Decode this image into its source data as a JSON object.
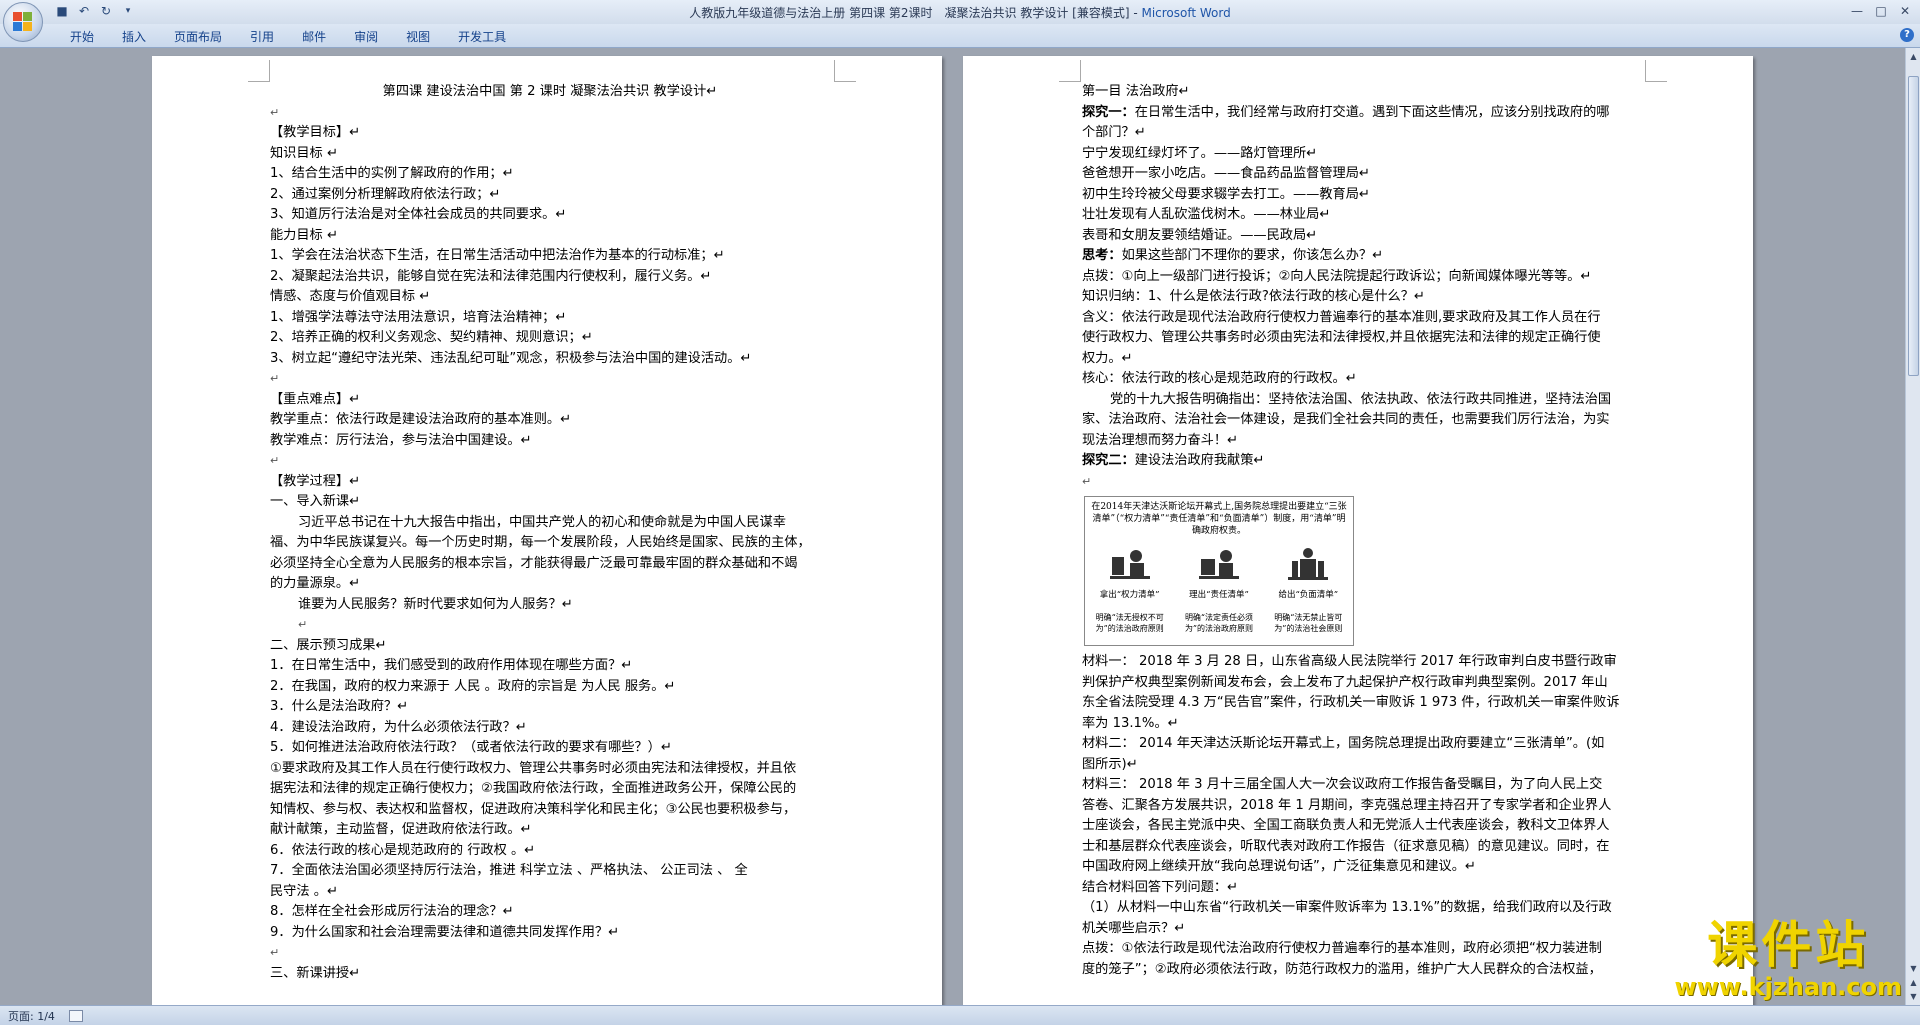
{
  "window": {
    "title": "人教版九年级道德与法治上册 第四课 第2课时　凝聚法治共识 教学设计 [兼容模式] - ",
    "app_name": "Microsoft Word"
  },
  "ribbon": {
    "tabs": [
      "开始",
      "插入",
      "页面布局",
      "引用",
      "邮件",
      "审阅",
      "视图",
      "开发工具"
    ]
  },
  "left_page": {
    "lines": [
      {
        "text": "第四课  建设法治中国    第 2 课时    凝聚法治共识    教学设计↵",
        "style": "center"
      },
      {
        "text": "↵",
        "style": "mark"
      },
      {
        "text": "【教学目标】↵",
        "style": ""
      },
      {
        "text": "知识目标      ↵",
        "style": ""
      },
      {
        "text": "1、结合生活中的实例了解政府的作用；↵",
        "style": ""
      },
      {
        "text": "2、通过案例分析理解政府依法行政；↵",
        "style": ""
      },
      {
        "text": "3、知道厉行法治是对全体社会成员的共同要求。↵",
        "style": ""
      },
      {
        "text": "能力目标      ↵",
        "style": ""
      },
      {
        "text": "1、学会在法治状态下生活，在日常生活活动中把法治作为基本的行动标准；↵",
        "style": ""
      },
      {
        "text": "2、凝聚起法治共识，能够自觉在宪法和法律范围内行使权利，履行义务。↵",
        "style": ""
      },
      {
        "text": "情感、态度与价值观目标    ↵",
        "style": ""
      },
      {
        "text": "1、增强学法尊法守法用法意识，培育法治精神；↵",
        "style": ""
      },
      {
        "text": "2、培养正确的权利义务观念、契约精神、规则意识；↵",
        "style": ""
      },
      {
        "text": "3、树立起“遵纪守法光荣、违法乱纪可耻”观念，积极参与法治中国的建设活动。↵",
        "style": ""
      },
      {
        "text": "↵",
        "style": "mark"
      },
      {
        "text": "【重点难点】↵",
        "style": ""
      },
      {
        "text": "教学重点：依法行政是建设法治政府的基本准则。↵",
        "style": ""
      },
      {
        "text": "教学难点：厉行法治，参与法治中国建设。↵",
        "style": ""
      },
      {
        "text": "↵",
        "style": "mark"
      },
      {
        "text": "【教学过程】↵",
        "style": ""
      },
      {
        "text": "一、导入新课↵",
        "style": ""
      },
      {
        "text": "习近平总书记在十九大报告中指出，中国共产党人的初心和使命就是为中国人民谋幸",
        "style": "indent"
      },
      {
        "text": "福、为中华民族谋复兴。每一个历史时期，每一个发展阶段，人民始终是国家、民族的主体，",
        "style": ""
      },
      {
        "text": "必须坚持全心全意为人民服务的根本宗旨，才能获得最广泛最可靠最牢固的群众基础和不竭",
        "style": ""
      },
      {
        "text": "的力量源泉。↵",
        "style": ""
      },
      {
        "text": "谁要为人民服务？新时代要求如何为人服务？↵",
        "style": "indent"
      },
      {
        "text": "↵",
        "style": "mark indent"
      },
      {
        "text": "二、展示预习成果↵",
        "style": ""
      },
      {
        "text": "1．在日常生活中，我们感受到的政府作用体现在哪些方面？↵",
        "style": ""
      },
      {
        "text": "2．在我国，政府的权力来源于   人民   。政府的宗旨是   为人民   服务。↵",
        "style": ""
      },
      {
        "text": "3．什么是法治政府？↵",
        "style": ""
      },
      {
        "text": "4．建设法治政府，为什么必须依法行政？↵",
        "style": ""
      },
      {
        "text": "5．如何推进法治政府依法行政？（或者依法行政的要求有哪些？）↵",
        "style": ""
      },
      {
        "text": "①要求政府及其工作人员在行使行政权力、管理公共事务时必须由宪法和法律授权，并且依",
        "style": ""
      },
      {
        "text": "据宪法和法律的规定正确行使权力；②我国政府依法行政，全面推进政务公开，保障公民的",
        "style": ""
      },
      {
        "text": "知情权、参与权、表达权和监督权，促进政府决策科学化和民主化；③公民也要积极参与，",
        "style": ""
      },
      {
        "text": "献计献策，主动监督，促进政府依法行政。↵",
        "style": ""
      },
      {
        "text": "6．依法行政的核心是规范政府的   行政权   。↵",
        "style": ""
      },
      {
        "text": "7．全面依法治国必须坚持厉行法治，推进   科学立法   、严格执法、   公正司法   、   全",
        "style": ""
      },
      {
        "text": "民守法   。↵",
        "style": ""
      },
      {
        "text": "8．怎样在全社会形成厉行法治的理念？↵",
        "style": ""
      },
      {
        "text": "9．为什么国家和社会治理需要法律和道德共同发挥作用？↵",
        "style": ""
      },
      {
        "text": "↵",
        "style": "mark"
      },
      {
        "text": "三、新课讲授↵",
        "style": ""
      }
    ]
  },
  "right_page": {
    "lines_top": [
      {
        "text": "第一目    法治政府↵",
        "style": ""
      },
      {
        "text": "探究一：在日常生活中，我们经常与政府打交道。遇到下面这些情况，应该分别找政府的哪",
        "style": "bold-lead"
      },
      {
        "text": "个部门？↵",
        "style": ""
      },
      {
        "text": "宁宁发现红绿灯坏了。——路灯管理所↵",
        "style": ""
      },
      {
        "text": "爸爸想开一家小吃店。——食品药品监督管理局↵",
        "style": ""
      },
      {
        "text": "初中生玲玲被父母要求辍学去打工。——教育局↵",
        "style": ""
      },
      {
        "text": "壮壮发现有人乱砍滥伐树木。——林业局↵",
        "style": ""
      },
      {
        "text": "表哥和女朋友要领结婚证。——民政局↵",
        "style": ""
      },
      {
        "text": "思考：如果这些部门不理你的要求，你该怎么办？↵",
        "style": "bold-lead"
      },
      {
        "text": "点拨：①向上一级部门进行投诉；②向人民法院提起行政诉讼；向新闻媒体曝光等等。↵",
        "style": ""
      },
      {
        "text": "知识归纳：1、什么是依法行政?依法行政的核心是什么？↵",
        "style": ""
      },
      {
        "text": "含义：依法行政是现代法治政府行使权力普遍奉行的基本准则,要求政府及其工作人员在行",
        "style": ""
      },
      {
        "text": "使行政权力、管理公共事务时必须由宪法和法律授权,并且依据宪法和法律的规定正确行使",
        "style": ""
      },
      {
        "text": "权力。↵",
        "style": ""
      },
      {
        "text": "核心：依法行政的核心是规范政府的行政权。↵",
        "style": ""
      },
      {
        "text": "党的十九大报告明确指出：坚持依法治国、依法执政、依法行政共同推进，坚持法治国",
        "style": "indent"
      },
      {
        "text": "家、法治政府、法治社会一体建设，是我们全社会共同的责任，也需要我们厉行法治，为实",
        "style": ""
      },
      {
        "text": "现法治理想而努力奋斗！↵",
        "style": ""
      },
      {
        "text": "探究二：建设法治政府我献策↵",
        "style": "bold-lead"
      },
      {
        "text": "↵",
        "style": "mark"
      }
    ],
    "figure": {
      "caption": "在2014年天津达沃斯论坛开幕式上,国务院总理提出要建立“三张清单”（“权力清单”“责任清单”和“负面清单”）制度，用“清单”明确政府权责。",
      "items": [
        {
          "label": "拿出“权力清单”",
          "sub": "明确“法无授权不可为”的法治政府原则"
        },
        {
          "label": "理出“责任清单”",
          "sub": "明确“法定责任必须为”的法治政府原则"
        },
        {
          "label": "给出“负面清单”",
          "sub": "明确“法无禁止皆可为”的法治社会原则"
        }
      ]
    },
    "lines_bottom": [
      {
        "text": "材料一：  2018 年 3 月 28 日，山东省高级人民法院举行 2017 年行政审判白皮书暨行政审",
        "style": ""
      },
      {
        "text": "判保护产权典型案例新闻发布会，会上发布了九起保护产权行政审判典型案例。2017 年山",
        "style": ""
      },
      {
        "text": "东全省法院受理 4.3 万“民告官”案件，行政机关一审败诉 1 973 件，行政机关一审案件败诉",
        "style": ""
      },
      {
        "text": "率为 13.1%。↵",
        "style": ""
      },
      {
        "text": "材料二：  2014 年天津达沃斯论坛开幕式上，国务院总理提出政府要建立“三张清单”。(如",
        "style": ""
      },
      {
        "text": "图所示)↵",
        "style": ""
      },
      {
        "text": "材料三：  2018 年 3 月十三届全国人大一次会议政府工作报告备受瞩目，为了向人民上交",
        "style": ""
      },
      {
        "text": "答卷、汇聚各方发展共识，2018 年 1 月期间，李克强总理主持召开了专家学者和企业界人",
        "style": ""
      },
      {
        "text": "士座谈会，各民主党派中央、全国工商联负责人和无党派人士代表座谈会，教科文卫体界人",
        "style": ""
      },
      {
        "text": "士和基层群众代表座谈会，听取代表对政府工作报告（征求意见稿）的意见建议。同时，在",
        "style": ""
      },
      {
        "text": "中国政府网上继续开放“我向总理说句话”，广泛征集意见和建议。↵",
        "style": ""
      },
      {
        "text": "结合材料回答下列问题：↵",
        "style": ""
      },
      {
        "text": "（1）从材料一中山东省“行政机关一审案件败诉率为 13.1%”的数据，给我们政府以及行政",
        "style": ""
      },
      {
        "text": "机关哪些启示？↵",
        "style": ""
      },
      {
        "text": "点拨：①依法行政是现代法治政府行使权力普遍奉行的基本准则，政府必须把“权力装进制",
        "style": ""
      },
      {
        "text": "度的笼子”；②政府必须依法行政，防范行政权力的滥用，维护广大人民群众的合法权益，",
        "style": ""
      }
    ]
  },
  "status": {
    "page_indicator": "页面: 1/4"
  },
  "watermark": {
    "title": "课件站",
    "url": "www.kjzhan.com"
  }
}
